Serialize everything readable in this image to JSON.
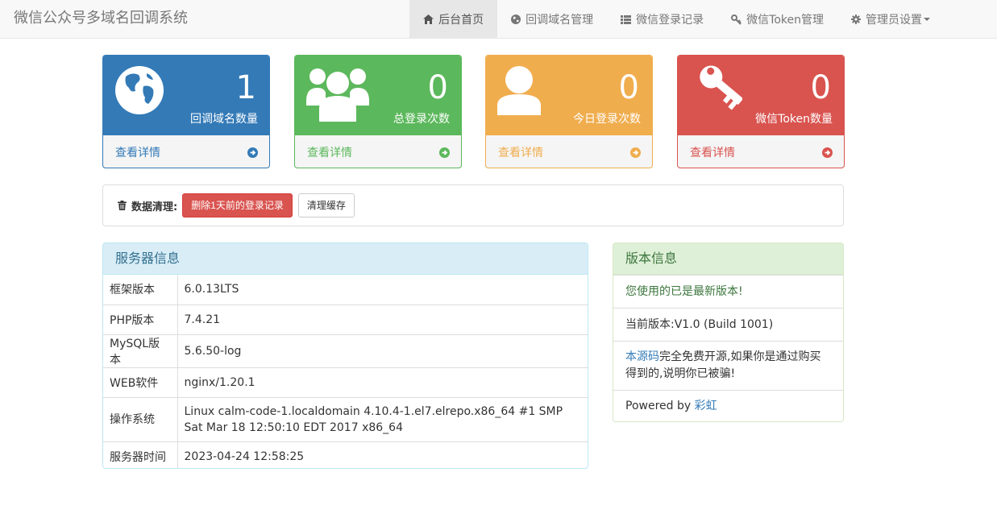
{
  "brand": "微信公众号多域名回调系统",
  "nav": [
    {
      "label": "后台首页",
      "icon": "home-icon"
    },
    {
      "label": "回调域名管理",
      "icon": "globe-icon"
    },
    {
      "label": "微信登录记录",
      "icon": "list-icon"
    },
    {
      "label": "微信Token管理",
      "icon": "key-icon"
    },
    {
      "label": "管理员设置",
      "icon": "gear-icon"
    }
  ],
  "cards": [
    {
      "value": "1",
      "label": "回调域名数量",
      "link": "查看详情",
      "icon": "globe-icon",
      "color": "#337ab7"
    },
    {
      "value": "0",
      "label": "总登录次数",
      "link": "查看详情",
      "icon": "users-icon",
      "color": "#5cb85c"
    },
    {
      "value": "0",
      "label": "今日登录次数",
      "link": "查看详情",
      "icon": "user-icon",
      "color": "#f0ad4e"
    },
    {
      "value": "0",
      "label": "微信Token数量",
      "link": "查看详情",
      "icon": "key-icon",
      "color": "#d9534f"
    }
  ],
  "cleanup": {
    "title": "数据清理:",
    "delete_btn": "删除1天前的登录记录",
    "cache_btn": "清理缓存"
  },
  "server": {
    "title": "服务器信息",
    "rows": [
      {
        "k": "框架版本",
        "v": "6.0.13LTS"
      },
      {
        "k": "PHP版本",
        "v": "7.4.21"
      },
      {
        "k": "MySQL版本",
        "v": "5.6.50-log"
      },
      {
        "k": "WEB软件",
        "v": "nginx/1.20.1"
      },
      {
        "k": "操作系统",
        "v": "Linux calm-code-1.localdomain 4.10.4-1.el7.elrepo.x86_64 #1 SMP Sat Mar 18 12:50:10 EDT 2017 x86_64"
      },
      {
        "k": "服务器时间",
        "v": "2023-04-24 12:58:25"
      }
    ]
  },
  "version": {
    "title": "版本信息",
    "latest": "您使用的已是最新版本!",
    "current": "当前版本:V1.0 (Build 1001)",
    "source_link": "本源码",
    "source_text": "完全免费开源,如果你是通过购买得到的,说明你已被骗!",
    "powered_prefix": "Powered by ",
    "powered_link": "彩虹"
  }
}
